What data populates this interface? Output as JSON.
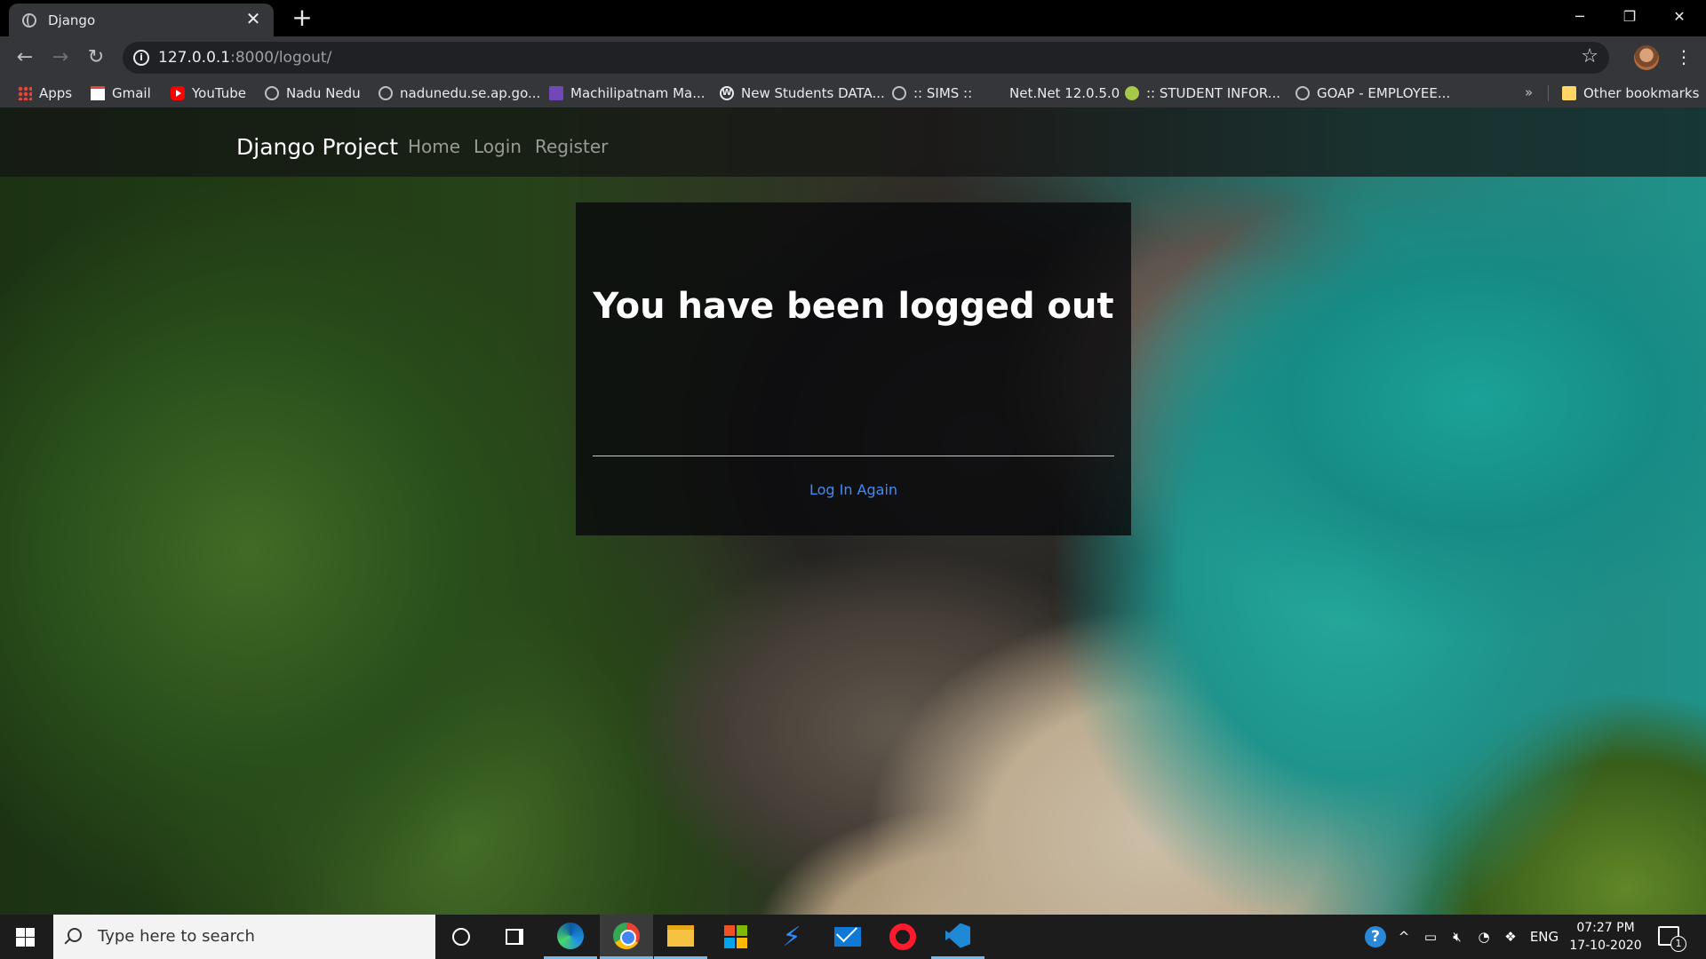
{
  "browser": {
    "tab_title": "Django",
    "tab_close": "✕",
    "new_tab": "+",
    "url_host": "127.0.0.1",
    "url_path": ":8000/logout/",
    "info_icon": "i",
    "star_icon": "☆",
    "menu_icon": "⋮",
    "window_controls": {
      "minimize": "─",
      "restore": "❐",
      "close": "✕"
    },
    "nav": {
      "back": "←",
      "forward": "→",
      "reload": "↻"
    }
  },
  "bookmarks": {
    "items": [
      {
        "label": "Apps",
        "icon": "apps-icon"
      },
      {
        "label": "Gmail",
        "icon": "gmail-icon"
      },
      {
        "label": "YouTube",
        "icon": "youtube-icon"
      },
      {
        "label": "Nadu Nedu",
        "icon": "globe-icon"
      },
      {
        "label": "nadunedu.se.ap.go...",
        "icon": "globe-icon"
      },
      {
        "label": "Machilipatnam Ma...",
        "icon": "forms-icon"
      },
      {
        "label": "New Students DATA...",
        "icon": "wordpress-icon"
      },
      {
        "label": ":: SIMS ::",
        "icon": "globe-icon"
      },
      {
        "label": "Net.Net 12.0.5.0",
        "icon": "none"
      },
      {
        "label": ":: STUDENT INFOR...",
        "icon": "green-circle-icon"
      },
      {
        "label": "GOAP - EMPLOYEE...",
        "icon": "globe-icon"
      }
    ],
    "more": "»",
    "other": "Other bookmarks"
  },
  "site": {
    "brand": "Django Project",
    "nav": {
      "home": "Home",
      "login": "Login",
      "register": "Register"
    },
    "card": {
      "heading": "You have been logged out",
      "link": "Log In Again"
    }
  },
  "taskbar": {
    "search_placeholder": "Type here to search",
    "language": "ENG",
    "time": "07:27 PM",
    "date": "17-10-2020",
    "help": "?",
    "tray_up": "^",
    "notification_count": "1",
    "accent": "#76b9ed"
  }
}
